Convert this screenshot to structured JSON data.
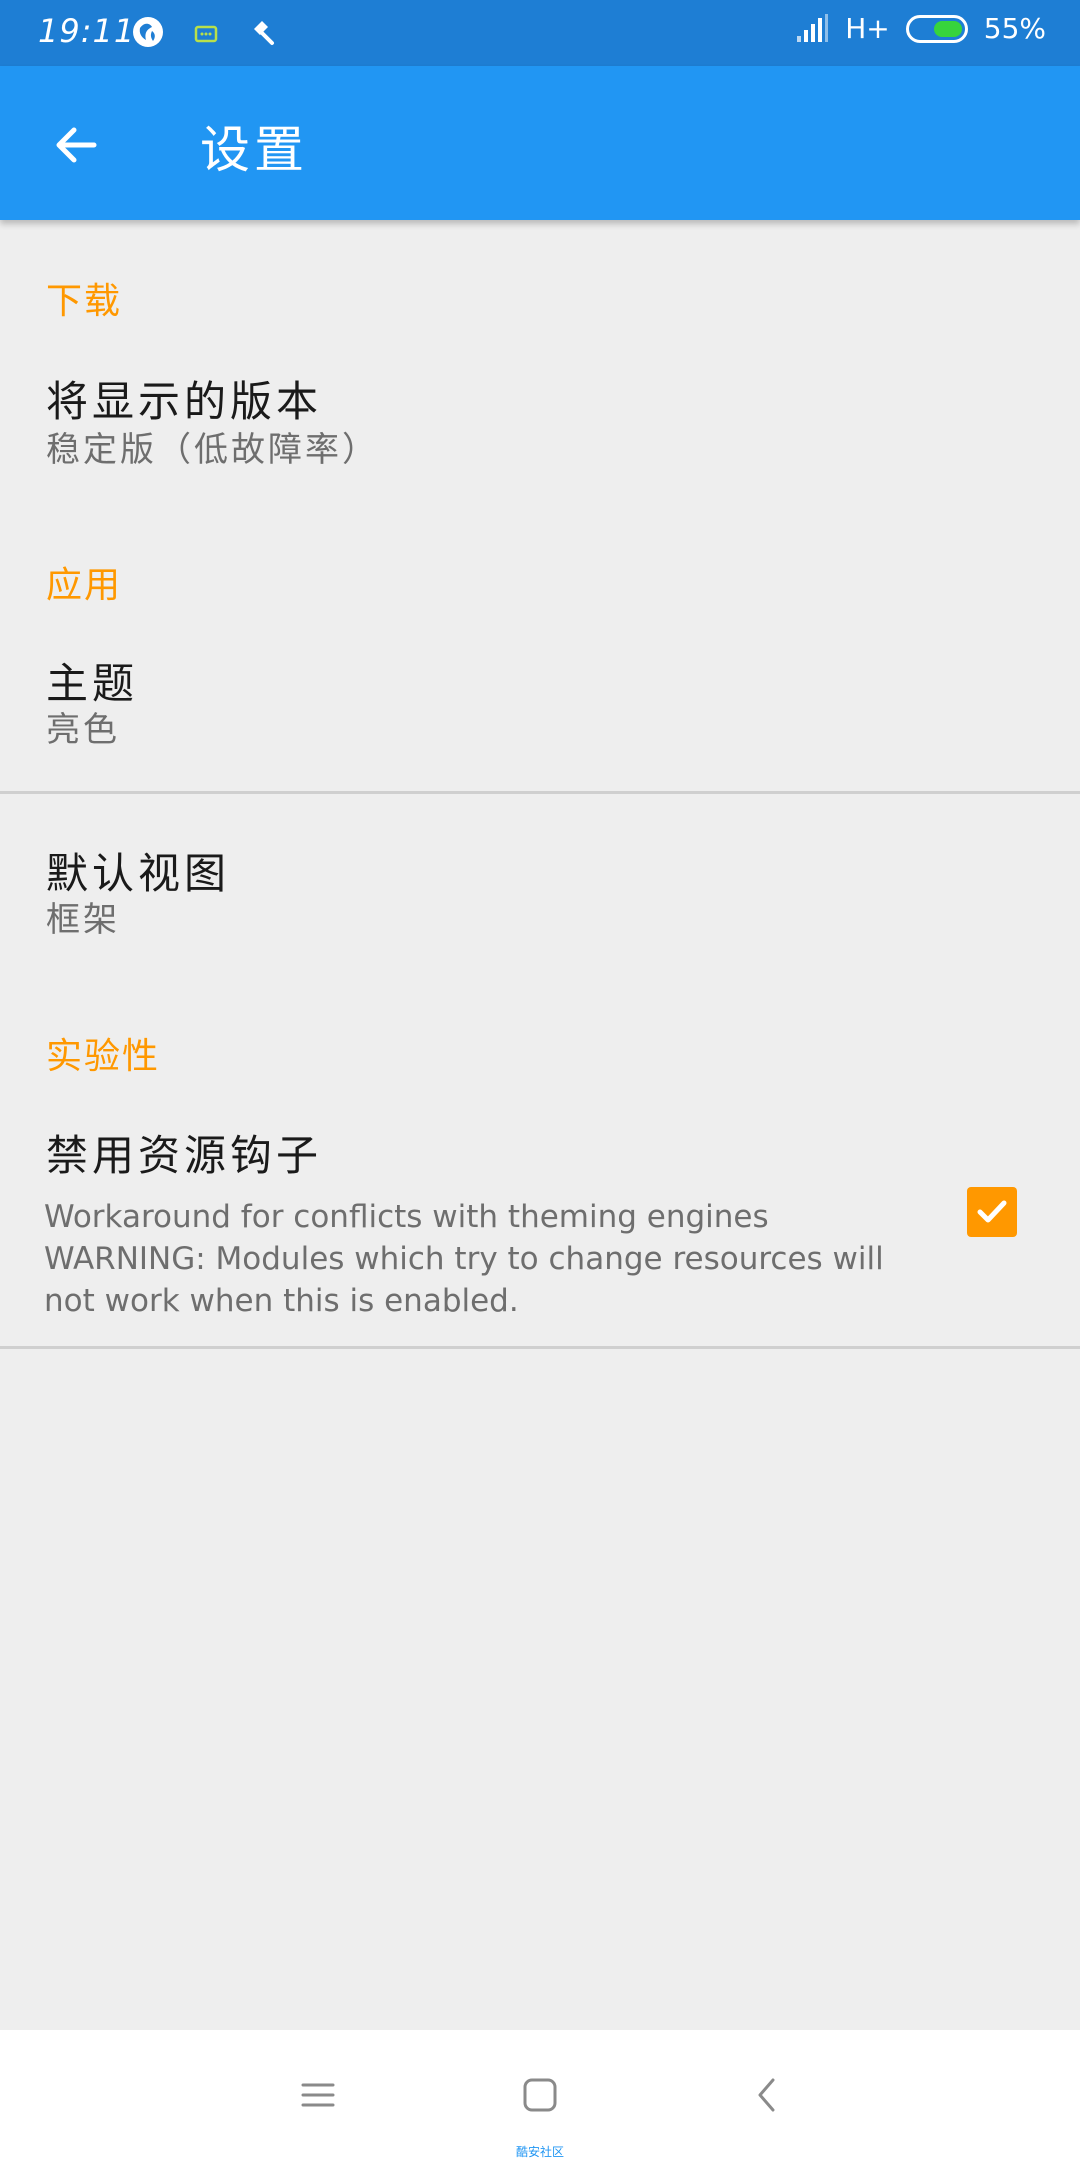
{
  "status_bar": {
    "time": "19:11",
    "network": "H+",
    "battery": "55%",
    "battery_level": 0.55,
    "icons": [
      "browser-icon",
      "message-icon",
      "hammer-icon",
      "signal-icon",
      "battery-icon"
    ]
  },
  "app_bar": {
    "title": "设置",
    "back_icon": "arrow-left-icon"
  },
  "sections": {
    "download": {
      "title": "下载",
      "version_title": "将显示的版本",
      "version_summary": "稳定版（低故障率）"
    },
    "app": {
      "title": "应用",
      "theme_title": "主题",
      "theme_summary": "亮色",
      "default_view_title": "默认视图",
      "default_view_summary": "框架"
    },
    "experimental": {
      "title": "实验性",
      "disable_hooks_title": "禁用资源钩子",
      "disable_hooks_summary": "Workaround for conflicts with theming engines\nWARNING: Modules which try to change resources will not work when this is enabled.",
      "disable_hooks_checked": true
    }
  },
  "nav_bar": {
    "icons": [
      "menu-icon",
      "home-icon",
      "back-icon"
    ],
    "watermark": "酷安社区"
  },
  "colors": {
    "status_bar": "#1e7ed4",
    "app_bar": "#2196f3",
    "accent": "#ff9800",
    "background": "#eeeeee",
    "battery": "#37d43c"
  }
}
